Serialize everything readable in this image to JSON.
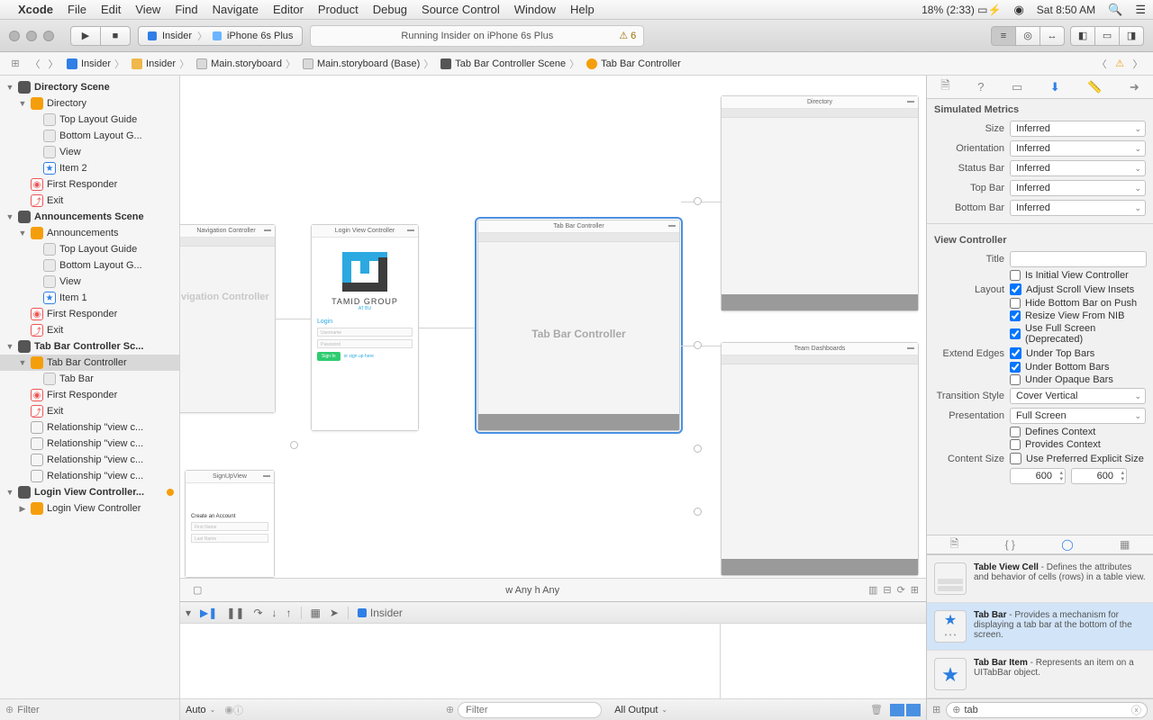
{
  "menubar": {
    "app": "Xcode",
    "items": [
      "File",
      "Edit",
      "View",
      "Find",
      "Navigate",
      "Editor",
      "Product",
      "Debug",
      "Source Control",
      "Window",
      "Help"
    ],
    "battery": "18% (2:33)",
    "clock": "Sat 8:50 AM"
  },
  "toolbar": {
    "scheme_target": "Insider",
    "scheme_device": "iPhone 6s Plus",
    "activity": "Running Insider on iPhone 6s Plus",
    "warn_count": "6"
  },
  "jumpbar": {
    "crumbs": [
      "Insider",
      "Insider",
      "Main.storyboard",
      "Main.storyboard (Base)",
      "Tab Bar Controller Scene",
      "Tab Bar Controller"
    ]
  },
  "navigator": {
    "scenes": [
      {
        "title": "Directory Scene",
        "vc": "Directory",
        "children": [
          "Top Layout Guide",
          "Bottom Layout G...",
          "View",
          "Item 2"
        ]
      },
      {
        "title": "Announcements Scene",
        "vc": "Announcements",
        "children": [
          "Top Layout Guide",
          "Bottom Layout G...",
          "View",
          "Item 1"
        ]
      },
      {
        "title": "Tab Bar Controller Sc...",
        "vc": "Tab Bar Controller",
        "tabbar": "Tab Bar",
        "rels": [
          "Relationship \"view c...",
          "Relationship \"view c...",
          "Relationship \"view c...",
          "Relationship \"view c..."
        ]
      },
      {
        "title": "Login View Controller...",
        "vc": "Login View Controller"
      }
    ],
    "first_responder": "First Responder",
    "exit": "Exit",
    "filter_placeholder": "Filter"
  },
  "canvas": {
    "nav_controller": "Navigation Controller",
    "nav_label": "vigation Controller",
    "login_title": "Login View Controller",
    "brand": "TAMID GROUP",
    "brand_sub": "AT BU",
    "login_label": "Login",
    "username_ph": "Username",
    "password_ph": "Password",
    "signin": "Sign In",
    "signup": "or sign up here",
    "signup_title": "SignUpView",
    "signup_h": "Create an Account",
    "signup_f1": "First Name",
    "signup_f2": "Last Name",
    "tbc_title": "Tab Bar Controller",
    "tbc_label": "Tab Bar Controller",
    "directory_title": "Directory",
    "team_title": "Team Dashboards",
    "size_class": "w Any  h Any"
  },
  "debug": {
    "process": "Insider",
    "auto": "Auto",
    "filter_placeholder": "Filter",
    "output_mode": "All Output"
  },
  "inspector": {
    "sim_header": "Simulated Metrics",
    "size_label": "Size",
    "size_val": "Inferred",
    "orient_label": "Orientation",
    "orient_val": "Inferred",
    "status_label": "Status Bar",
    "status_val": "Inferred",
    "topbar_label": "Top Bar",
    "topbar_val": "Inferred",
    "botbar_label": "Bottom Bar",
    "botbar_val": "Inferred",
    "vc_header": "View Controller",
    "title_label": "Title",
    "initial": "Is Initial View Controller",
    "layout_label": "Layout",
    "adjust": "Adjust Scroll View Insets",
    "hidebot": "Hide Bottom Bar on Push",
    "resize": "Resize View From NIB",
    "fullscreen": "Use Full Screen (Deprecated)",
    "extend_label": "Extend Edges",
    "undertop": "Under Top Bars",
    "underbot": "Under Bottom Bars",
    "underopq": "Under Opaque Bars",
    "trans_label": "Transition Style",
    "trans_val": "Cover Vertical",
    "pres_label": "Presentation",
    "pres_val": "Full Screen",
    "defctx": "Defines Context",
    "provctx": "Provides Context",
    "csize_label": "Content Size",
    "prefexp": "Use Preferred Explicit Size",
    "w": "600",
    "h": "600"
  },
  "library": {
    "items": [
      {
        "name": "Table View Cell",
        "desc": " - Defines the attributes and behavior of cells (rows) in a table view."
      },
      {
        "name": "Tab Bar",
        "desc": " - Provides a mechanism for displaying a tab bar at the bottom of the screen."
      },
      {
        "name": "Tab Bar Item",
        "desc": " - Represents an item on a UITabBar object."
      }
    ],
    "filter": "tab"
  }
}
